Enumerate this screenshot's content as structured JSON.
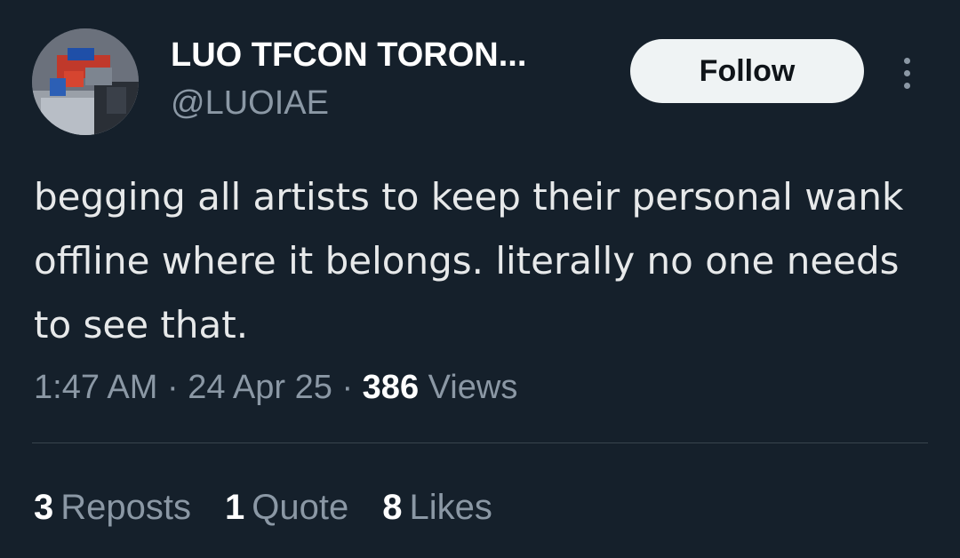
{
  "author": {
    "display_name": "LUO TFCON TORON...",
    "handle": "@LUOIAE",
    "avatar_icon": "toy-robot-photo-avatar"
  },
  "actions": {
    "follow_label": "Follow",
    "more_icon": "more-vertical-icon"
  },
  "tweet": {
    "text": "begging all artists to keep their personal wank offline where it belongs. literally no one needs to see that.",
    "time": "1:47 AM",
    "separator": "·",
    "date": "24 Apr 25",
    "views_count": "386",
    "views_label": "Views"
  },
  "stats": {
    "reposts_count": "3",
    "reposts_label": "Reposts",
    "quotes_count": "1",
    "quotes_label": "Quote",
    "likes_count": "8",
    "likes_label": "Likes"
  },
  "colors": {
    "background": "#15202b",
    "primary_text": "#e7e9ea",
    "secondary_text": "#8b98a5",
    "divider": "#38444d",
    "follow_button_bg": "#eff3f4"
  }
}
